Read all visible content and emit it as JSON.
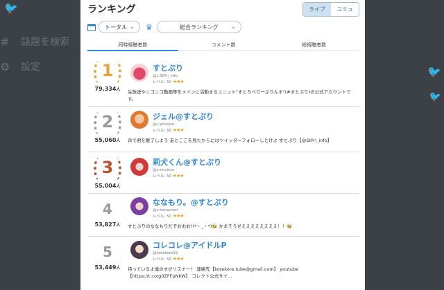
{
  "background": {
    "items": [
      {
        "icon": "hashtag-icon",
        "glyph": "#",
        "label": "話題を検索"
      },
      {
        "icon": "gear-icon",
        "glyph": "⚙",
        "label": "設定"
      }
    ]
  },
  "modal": {
    "title": "ランキング",
    "toggle": {
      "live": "ライブ",
      "community": "コミュ"
    },
    "filters": {
      "period": "トータル",
      "category": "総合ランキング"
    },
    "tabs": [
      "同時視聴者数",
      "コメント数",
      "総視聴者数"
    ]
  },
  "colors": {
    "accent": "#2f87d8",
    "gold": "#e9a23b",
    "silver": "#9a9a9a",
    "bronze": "#b4552d",
    "stars": "#f0a020"
  },
  "rankings": [
    {
      "rank": "1",
      "count": "79,334",
      "unit": "人",
      "name": "すとぷり",
      "handle": "@c:StPri_info",
      "level": "レベル: 50",
      "stars": "★★★",
      "desc": "生放送やニコニコ動画等をメインに活動するユニット\"すとろべりーぷりんす\"(#すとぷり)の公式アカウントです。"
    },
    {
      "rank": "2",
      "count": "55,060",
      "unit": "人",
      "name": "ジェル@すとぷり",
      "handle": "@c:jelvoice",
      "level": "レベル: 50",
      "stars": "★★★",
      "desc": "声で君を魅了しよう あとここを見たからにはツイッターフォローしとけよ すとぷり【@StPri_info】"
    },
    {
      "rank": "3",
      "count": "55,004",
      "unit": "人",
      "name": "莉犬くん@すとぷり",
      "handle": "@c:rinukun",
      "level": "レベル: 50",
      "stars": "★★★",
      "desc": ""
    },
    {
      "rank": "4",
      "count": "53,827",
      "unit": "人",
      "name": "ななもり。@すとぷり",
      "handle": "@c:nanamori",
      "level": "レベル: 50",
      "stars": "★★★",
      "desc": "すとぷりのななもりだぞおおお!(*・_・*)🐝 かまそうぜええええええええ！！🐝"
    },
    {
      "rank": "5",
      "count": "53,449",
      "unit": "人",
      "name": "コレコレ@アイドルP",
      "handle": "@korekore19",
      "level": "レベル: 50",
      "stars": "★★★",
      "desc": "待っているよ僕のすぜリスナー！ 連絡先【korekore.tube@gmail.com】 youtube【https://t.co/g0ZFFpNKW】 コレクト公式サイ..."
    }
  ]
}
